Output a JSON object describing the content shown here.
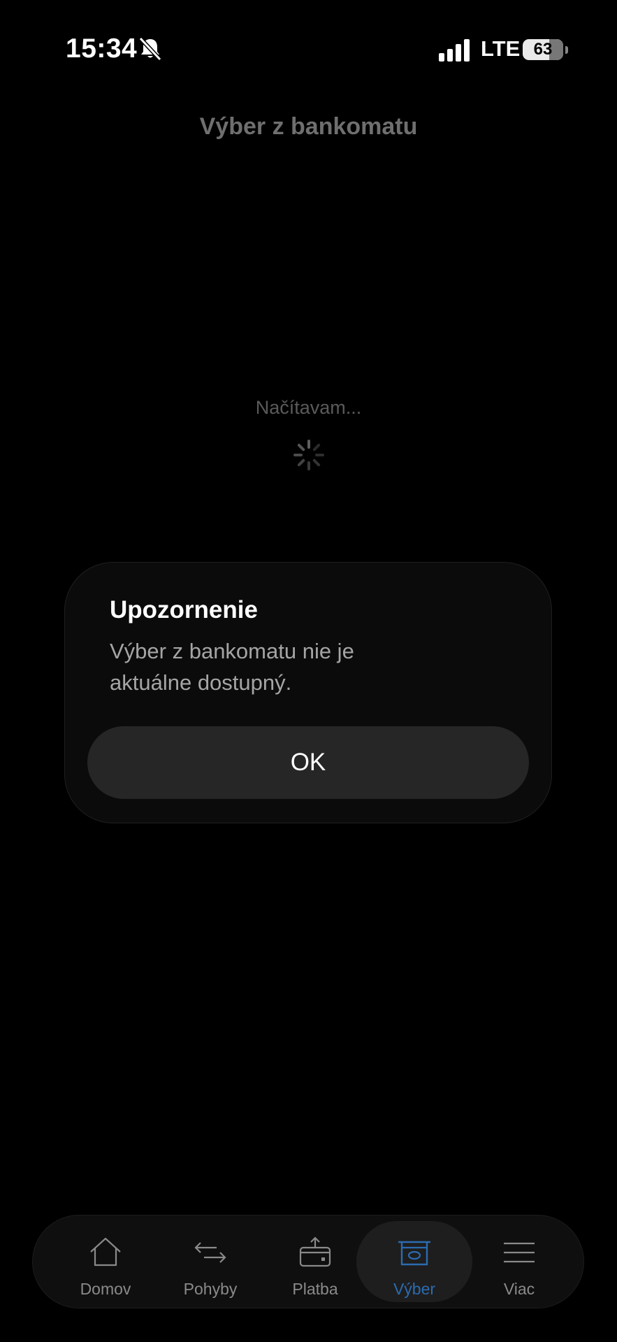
{
  "status_bar": {
    "time": "15:34",
    "network": "LTE",
    "battery": "63"
  },
  "header": {
    "title": "Výber z bankomatu"
  },
  "loading": {
    "text": "Načítavam..."
  },
  "dialog": {
    "title": "Upozornenie",
    "message": "Výber z bankomatu nie je aktuálne dostupný.",
    "ok_label": "OK"
  },
  "tab_bar": {
    "active_color": "#2b6bb0",
    "items": [
      {
        "label": "Domov",
        "icon": "home-icon"
      },
      {
        "label": "Pohyby",
        "icon": "transfer-arrows-icon"
      },
      {
        "label": "Platba",
        "icon": "payment-wallet-icon"
      },
      {
        "label": "Výber",
        "icon": "atm-withdrawal-icon",
        "active": true
      },
      {
        "label": "Viac",
        "icon": "menu-icon"
      }
    ]
  }
}
